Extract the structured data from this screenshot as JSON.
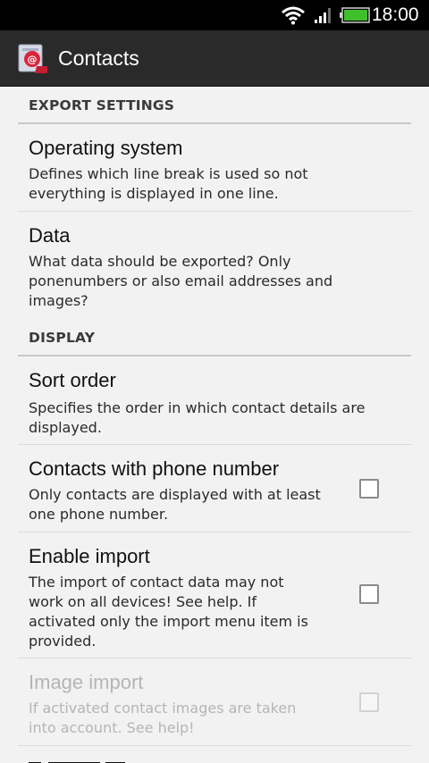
{
  "status_bar": {
    "time": "18:00",
    "icons": [
      "wifi-icon",
      "signal-icon",
      "battery-icon"
    ],
    "battery_color": "#3fbf2a"
  },
  "action_bar": {
    "title": "Contacts",
    "icon": "contacts-app-icon"
  },
  "sections": [
    {
      "header": "EXPORT SETTINGS",
      "items": [
        {
          "title": "Operating system",
          "summary": "Defines which line break is used so not everything is displayed in one line.",
          "summary_lines": [
            "Defines which line break is used so not",
            "everything is displayed in one line."
          ]
        },
        {
          "title": "Data",
          "summary": "What data should be exported? Only ponenumbers or also email addresses and images?",
          "summary_lines": [
            "What data should be exported? Only",
            "ponenumbers or also email addresses and",
            "images?"
          ]
        }
      ]
    },
    {
      "header": "DISPLAY",
      "items": [
        {
          "title": "Sort order",
          "summary": "Specifies the order in which contact details are displayed.",
          "summary_lines": [
            "Specifies the order in which contact details are",
            "displayed."
          ]
        },
        {
          "title": "Contacts with phone number",
          "summary": "Only contacts are displayed with at least one phone number.",
          "summary_lines": [
            "Only contacts are displayed with at least",
            "one phone number."
          ],
          "checked": false
        },
        {
          "title": "Enable import",
          "summary": "The import of contact data may not work on all devices! See help. If activated only the import menu item is provided.",
          "summary_lines": [
            "The import of contact data may not",
            "work on all devices! See help. If",
            "activated only the import menu item is",
            "provided."
          ],
          "checked": false
        },
        {
          "title": "Image import",
          "summary": "If activated contact images are taken into account. See help!",
          "summary_lines": [
            "If activated contact images are taken",
            "into account. See help!"
          ],
          "checked": false,
          "enabled": false
        }
      ]
    }
  ]
}
